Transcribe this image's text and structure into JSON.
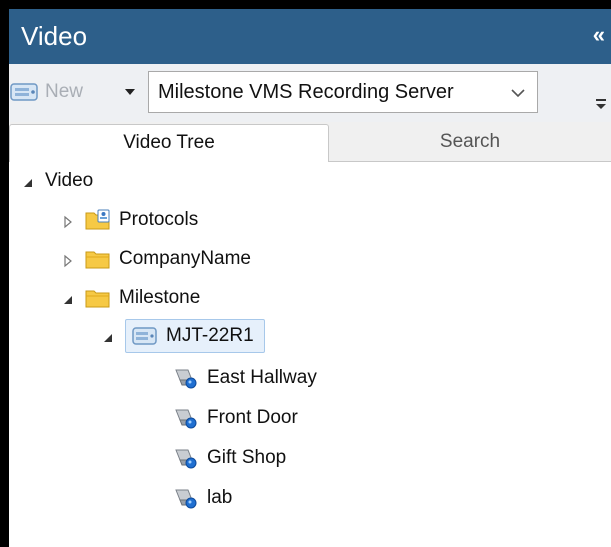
{
  "panel": {
    "title": "Video",
    "collapse_glyph": "«",
    "collapse_icon": "double-chevron-left-icon"
  },
  "toolbar": {
    "new_label": "New",
    "new_icon": "server-icon",
    "server_select": {
      "value": "Milestone VMS Recording Server"
    }
  },
  "tabs": [
    {
      "label": "Video Tree",
      "active": true
    },
    {
      "label": "Search",
      "active": false
    }
  ],
  "tree": {
    "root": {
      "label": "Video",
      "expanded": true
    },
    "folders": [
      {
        "label": "Protocols",
        "icon": "protocols-folder-icon",
        "expanded": false
      },
      {
        "label": "CompanyName",
        "icon": "folder-icon",
        "expanded": false
      },
      {
        "label": "Milestone",
        "icon": "folder-icon",
        "expanded": true
      }
    ],
    "server": {
      "label": "MJT-22R1",
      "icon": "server-icon",
      "selected": true,
      "expanded": true
    },
    "cameras": [
      {
        "label": "East Hallway",
        "icon": "camera-icon"
      },
      {
        "label": "Front Door",
        "icon": "camera-icon"
      },
      {
        "label": "Gift Shop",
        "icon": "camera-icon"
      },
      {
        "label": "lab",
        "icon": "camera-icon"
      }
    ]
  },
  "colors": {
    "titlebar": "#2d5f8a",
    "toolbar": "#eef0f3",
    "selection": "#e6f0fb",
    "selection_border": "#a7c8ea",
    "folder": "#f6c945"
  }
}
